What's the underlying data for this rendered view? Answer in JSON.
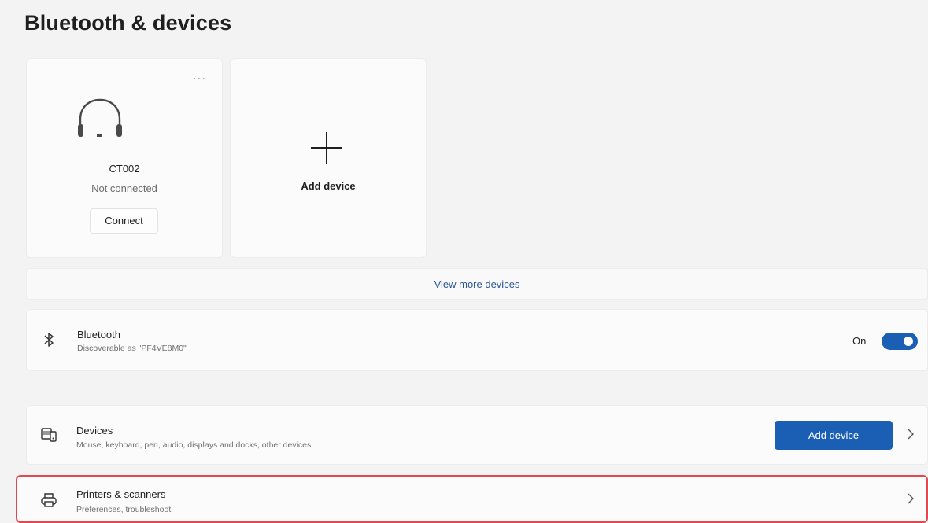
{
  "page": {
    "title": "Bluetooth & devices"
  },
  "device_card": {
    "name": "CT002",
    "status": "Not connected",
    "connect_label": "Connect",
    "more_label": "···",
    "icon": "headphones-icon"
  },
  "add_card": {
    "label": "Add device",
    "icon": "plus-icon"
  },
  "view_more": {
    "label": "View more devices"
  },
  "bluetooth": {
    "title": "Bluetooth",
    "subtitle": "Discoverable as \"PF4VE8M0\"",
    "toggle_label": "On",
    "toggle_on": true,
    "icon": "bluetooth-icon"
  },
  "devices": {
    "title": "Devices",
    "subtitle": "Mouse, keyboard, pen, audio, displays and docks, other devices",
    "button_label": "Add device",
    "icon": "devices-icon"
  },
  "printers": {
    "title": "Printers & scanners",
    "subtitle": "Preferences, troubleshoot",
    "icon": "printer-icon"
  },
  "colors": {
    "accent": "#1a5fb4",
    "highlight": "#e0494f",
    "link": "#2b5698"
  }
}
